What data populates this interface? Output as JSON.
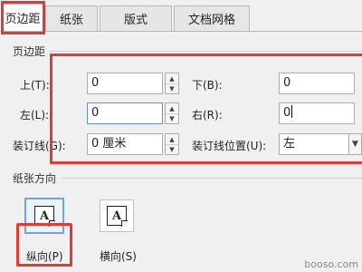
{
  "tabs": [
    {
      "label": "页边距",
      "active": true
    },
    {
      "label": "纸张",
      "active": false
    },
    {
      "label": "版式",
      "active": false
    },
    {
      "label": "文档网格",
      "active": false
    }
  ],
  "margins": {
    "section_label": "页边距",
    "top_label": "上(T):",
    "top_value": "0",
    "bottom_label": "下(B):",
    "bottom_value": "0",
    "left_label": "左(L):",
    "left_value": "0",
    "right_label": "右(R):",
    "right_value": "0",
    "gutter_label": "装订线(G):",
    "gutter_value": "0 厘米",
    "gutter_position_label": "装订线位置(U):",
    "gutter_position_value": "左"
  },
  "orientation": {
    "section_label": "纸张方向",
    "portrait_label": "纵向(P)",
    "landscape_label": "横向(S)",
    "selected": "portrait",
    "glyph": "A"
  },
  "watermark": "booso.com",
  "colors": {
    "highlight": "#e53935",
    "selected_border": "#6ea5dd"
  }
}
